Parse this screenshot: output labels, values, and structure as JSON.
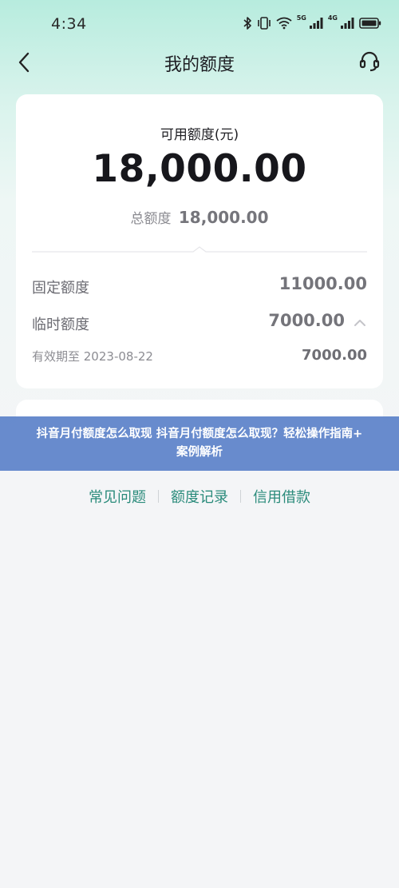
{
  "status_bar": {
    "time": "4:34",
    "network_labels": [
      "5G",
      "4G"
    ]
  },
  "nav": {
    "title": "我的额度"
  },
  "credit_card": {
    "available_label": "可用额度(元)",
    "available_amount": "18,000.00",
    "total_label": "总额度",
    "total_value": "18,000.00",
    "fixed_label": "固定额度",
    "fixed_value": "11000.00",
    "temp_label": "临时额度",
    "temp_value": "7000.00",
    "valid_label": "有效期至 2023-08-22",
    "valid_value": "7000.00"
  },
  "banner": {
    "line1": "抖音月付额度怎么取现 抖音月付额度怎么取现？轻松操作指南+",
    "line2": "案例解析"
  },
  "footer_links": [
    "常见问题",
    "额度记录",
    "信用借款"
  ],
  "colors": {
    "accent": "#2a8b7b",
    "banner": "#5b81c9",
    "header_gradient_top": "#b7ecde"
  }
}
